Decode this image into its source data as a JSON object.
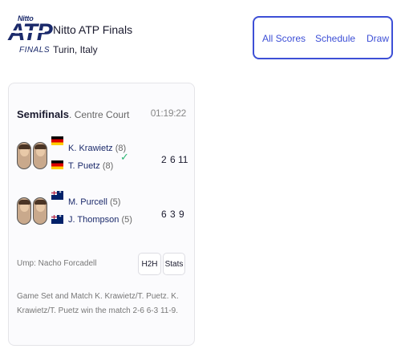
{
  "header": {
    "logo": {
      "top": "Nitto",
      "main": "ATP",
      "bottom": "FINALS"
    },
    "title": "Nitto ATP Finals",
    "location": "Turin, Italy"
  },
  "nav": {
    "all_scores": "All Scores",
    "schedule": "Schedule",
    "draw": "Draw"
  },
  "match": {
    "round": "Semifinals",
    "court": ". Centre Court",
    "duration": "01:19:22",
    "teams": [
      {
        "winner": true,
        "players": [
          {
            "name": "K. Krawietz",
            "seed": "(8)",
            "flag": "germany-flag-icon"
          },
          {
            "name": "T. Puetz",
            "seed": "(8)",
            "flag": "germany-flag-icon"
          }
        ],
        "scores": [
          "2",
          "6",
          "11"
        ]
      },
      {
        "winner": false,
        "players": [
          {
            "name": "M. Purcell",
            "seed": "(5)",
            "flag": "australia-flag-icon"
          },
          {
            "name": "J. Thompson",
            "seed": "(5)",
            "flag": "australia-flag-icon"
          }
        ],
        "scores": [
          "6",
          "3",
          "9"
        ]
      }
    ],
    "umpire": "Ump: Nacho Forcadell",
    "h2h_label": "H2H",
    "stats_label": "Stats",
    "summary": "Game Set and Match K. Krawietz/T. Puetz. K. Krawietz/T. Puetz win the match 2-6 6-3 11-9."
  },
  "colors": {
    "accent": "#3d4fd6",
    "brand": "#1b2a6b",
    "winner_check": "#2bb673"
  }
}
